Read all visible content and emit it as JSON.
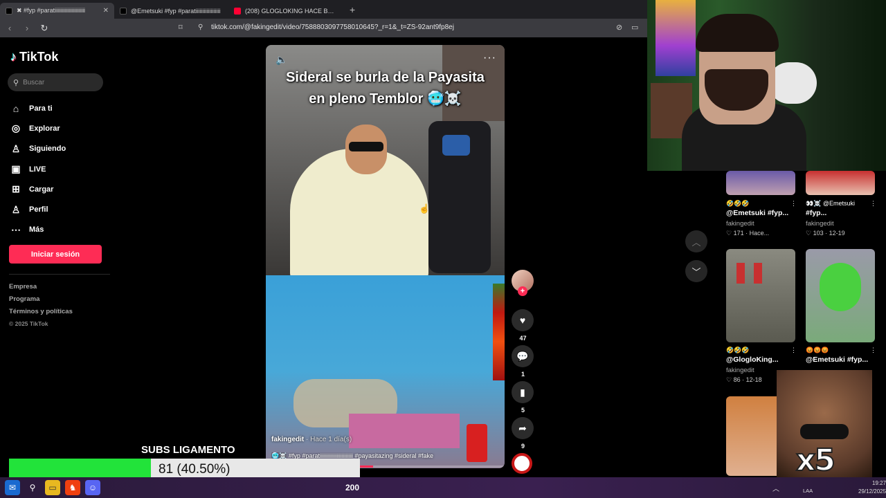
{
  "browser": {
    "tabs": [
      {
        "title": "✖ #fyp #paratiiiiiiiiiiiiiiiiiiiiii",
        "active": true,
        "fav_color": "#ffffff"
      },
      {
        "title": "@Emetsuki #fyp #paratiiiiiiiiiiiiiiiiii",
        "active": false,
        "fav_color": "#ffffff"
      },
      {
        "title": "(208) GLOGLOKING HACE BATIDOS L",
        "active": false,
        "fav_color": "#ff0033"
      }
    ],
    "new_tab": "+",
    "url": "tiktok.com/@fakingedit/video/7588803097758010645?_r=1&_t=ZS-92ant9fp8ej"
  },
  "sidebar": {
    "brand": "TikTok",
    "search_placeholder": "Buscar",
    "nav": [
      {
        "label": "Para ti",
        "icon": "home-icon",
        "glyph": "⌂"
      },
      {
        "label": "Explorar",
        "icon": "compass-icon",
        "glyph": "◎"
      },
      {
        "label": "Siguiendo",
        "icon": "following-icon",
        "glyph": "♙"
      },
      {
        "label": "LIVE",
        "icon": "live-icon",
        "glyph": "▣"
      },
      {
        "label": "Cargar",
        "icon": "upload-icon",
        "glyph": "⊞"
      },
      {
        "label": "Perfil",
        "icon": "profile-icon",
        "glyph": "♙"
      },
      {
        "label": "Más",
        "icon": "more-icon",
        "glyph": "⋯"
      }
    ],
    "login_label": "Iniciar sesión",
    "footer": [
      "Empresa",
      "Programa",
      "Términos y políticas"
    ],
    "copyright": "© 2025 TikTok"
  },
  "video": {
    "caption_line1": "Sideral se burla de la Payasita",
    "caption_line2": "en pleno Temblor 🥶☠️",
    "author": "fakingedit",
    "when": "· Hace 1 día(s)",
    "description": "🥶☠️ #fyp #paratiiiiiiiiiiiiiiiiiiiiiiii #payasitazing #sideral #fake",
    "progress": 0.45,
    "accent": "#fe2c55"
  },
  "actions": {
    "likes": "47",
    "comments": "1",
    "saves": "5",
    "shares": "9"
  },
  "feed": [
    {
      "emoji": "🤣🤣🤣",
      "title": "@Emetsuki #fyp...",
      "user": "fakingedit",
      "meta": "♡ 171 · Hace..."
    },
    {
      "emoji": "👀☠️ @Emetsuki",
      "title": "#fyp...",
      "user": "fakingedit",
      "meta": "♡ 103 · 12-19"
    },
    {
      "emoji": "🤣🤣🤣",
      "title": "@GlogloKing...",
      "user": "fakingedit",
      "meta": "♡ 86 · 12-18"
    },
    {
      "emoji": "😡😡😡",
      "title": "@Emetsuki #fyp...",
      "user": "",
      "meta": ""
    }
  ],
  "overlay": {
    "subs_label": "SUBS LIGAMENTO",
    "subs_text": "81 (40.50%)",
    "subs_fraction": 0.405,
    "meme_text": "x5"
  },
  "taskbar": {
    "center_number": "200",
    "lang": "LAA",
    "time": "19:27",
    "date": "29/12/2025"
  }
}
